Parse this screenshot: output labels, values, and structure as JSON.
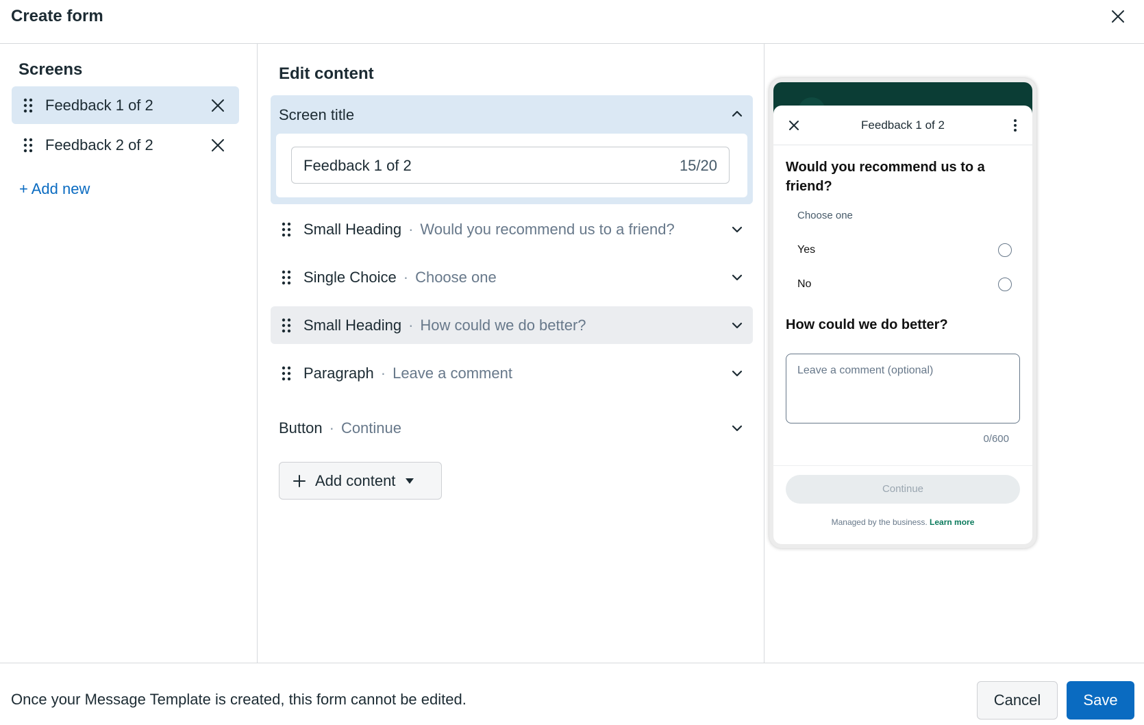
{
  "dialog": {
    "title": "Create form",
    "close_icon": "close-icon"
  },
  "screens": {
    "title": "Screens",
    "items": [
      {
        "label": "Feedback 1 of 2",
        "active": true
      },
      {
        "label": "Feedback 2 of 2",
        "active": false
      }
    ],
    "add_new": "+ Add new"
  },
  "edit": {
    "title": "Edit content",
    "screen_title": {
      "label": "Screen title",
      "value": "Feedback 1 of 2",
      "count": "15/20"
    },
    "items": [
      {
        "type": "Small Heading",
        "desc": "Would you recommend us to a friend?"
      },
      {
        "type": "Single Choice",
        "desc": "Choose one"
      },
      {
        "type": "Small Heading",
        "desc": "How could we do better?"
      },
      {
        "type": "Paragraph",
        "desc": "Leave a comment"
      }
    ],
    "button_row": {
      "type": "Button",
      "desc": "Continue"
    },
    "add_content": "Add content",
    "separator": "·"
  },
  "preview": {
    "header_title": "Feedback 1 of 2",
    "question1": "Would you recommend us to a friend?",
    "choose": "Choose one",
    "options": [
      "Yes",
      "No"
    ],
    "question2": "How could we do better?",
    "comment_placeholder": "Leave a comment (optional)",
    "counter": "0/600",
    "continue": "Continue",
    "managed": "Managed by the business.",
    "learn_more": "Learn more",
    "colors": {
      "header": "#0b3d35",
      "link": "#0b7a5c"
    }
  },
  "footer": {
    "message": "Once your Message Template is created, this form cannot be edited.",
    "cancel": "Cancel",
    "save": "Save"
  },
  "colors": {
    "accent": "#0a6bc1",
    "selected_bg": "#dbe8f4"
  }
}
